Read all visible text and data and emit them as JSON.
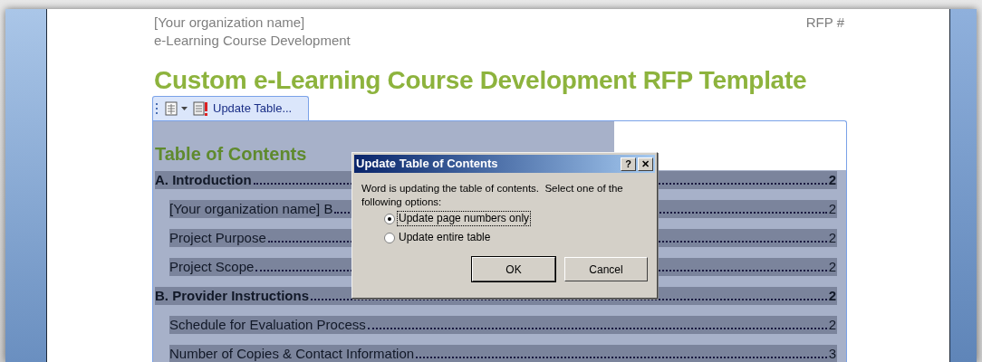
{
  "document": {
    "header_left": [
      "[Your organization name]",
      "e-Learning Course Development"
    ],
    "header_right": "RFP #",
    "title": "Custom e-Learning Course Development RFP Template"
  },
  "toc_toolbar": {
    "update_button": "Update Table..."
  },
  "toc": {
    "heading": "Table of Contents",
    "entries": [
      {
        "title": "A. Introduction",
        "page": "2",
        "children": [
          {
            "title": "[Your organization name] B",
            "page": "2"
          },
          {
            "title": "Project Purpose",
            "page": "2"
          },
          {
            "title": "Project Scope",
            "page": "2"
          }
        ]
      },
      {
        "title": "B. Provider Instructions",
        "page": "2",
        "children": [
          {
            "title": "Schedule for Evaluation Process",
            "page": "2"
          },
          {
            "title": "Number of Copies & Contact Information",
            "page": "3"
          }
        ]
      }
    ]
  },
  "dialog": {
    "title": "Update Table of Contents",
    "help_button": "?",
    "close_button": "✕",
    "message": "Word is updating the table of contents.  Select one of the following options:",
    "options": [
      {
        "label": "Update page numbers only",
        "selected": true
      },
      {
        "label": "Update entire table",
        "selected": false
      }
    ],
    "buttons": [
      "OK",
      "Cancel"
    ]
  }
}
